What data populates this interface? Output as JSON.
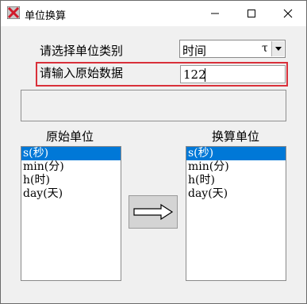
{
  "window": {
    "title": "单位换算"
  },
  "form": {
    "category_label": "请选择单位类别",
    "category_value": "时间",
    "category_suffix": "τ",
    "input_label": "请输入原始数据",
    "input_value": "122"
  },
  "source": {
    "heading": "原始单位",
    "items": [
      "s(秒)",
      "min(分)",
      "h(时)",
      "day(天)"
    ],
    "selected_index": 0
  },
  "target": {
    "heading": "换算单位",
    "items": [
      "s(秒)",
      "min(分)",
      "h(时)",
      "day(天)"
    ],
    "selected_index": 0
  },
  "colors": {
    "selection": "#0078d7",
    "highlight_border": "#d9303a"
  },
  "icons": [
    "app-icon",
    "minimize-icon",
    "maximize-icon",
    "close-icon",
    "right-arrow-icon",
    "dropdown-arrow-icon"
  ]
}
